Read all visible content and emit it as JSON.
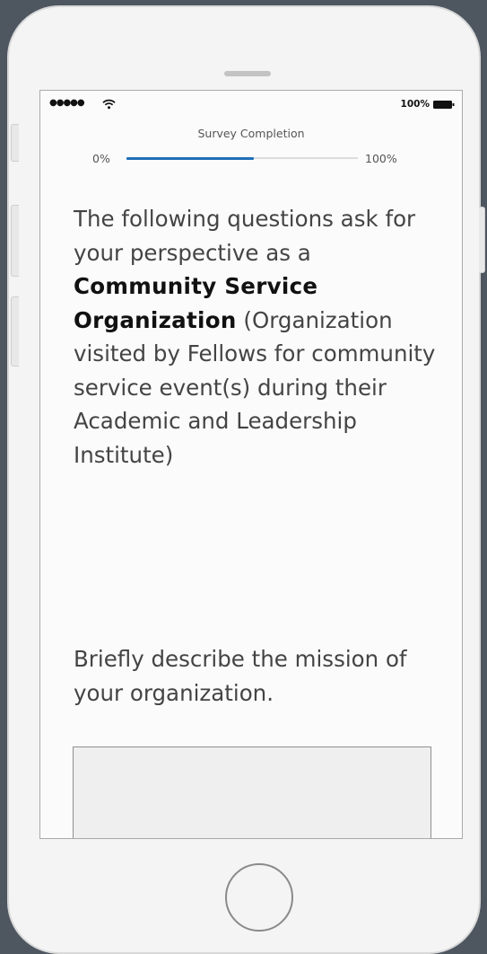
{
  "status_bar": {
    "signal": "●●●●●",
    "wifi_icon": "wifi-icon",
    "battery_percent": "100%",
    "battery_icon": "battery-icon"
  },
  "progress": {
    "title": "Survey Completion",
    "min_label": "0%",
    "max_label": "100%",
    "value_fraction": 0.55,
    "fill_color": "#1f6fb6"
  },
  "intro": {
    "lead": "The following questions ask for your perspective as a",
    "emphasis": "Community Service Organization",
    "detail": "(Organization visited by Fellows for community service event(s) during their Academic and Leadership Institute)"
  },
  "question": {
    "text": "Briefly describe the mission of your organization.",
    "answer_value": ""
  }
}
